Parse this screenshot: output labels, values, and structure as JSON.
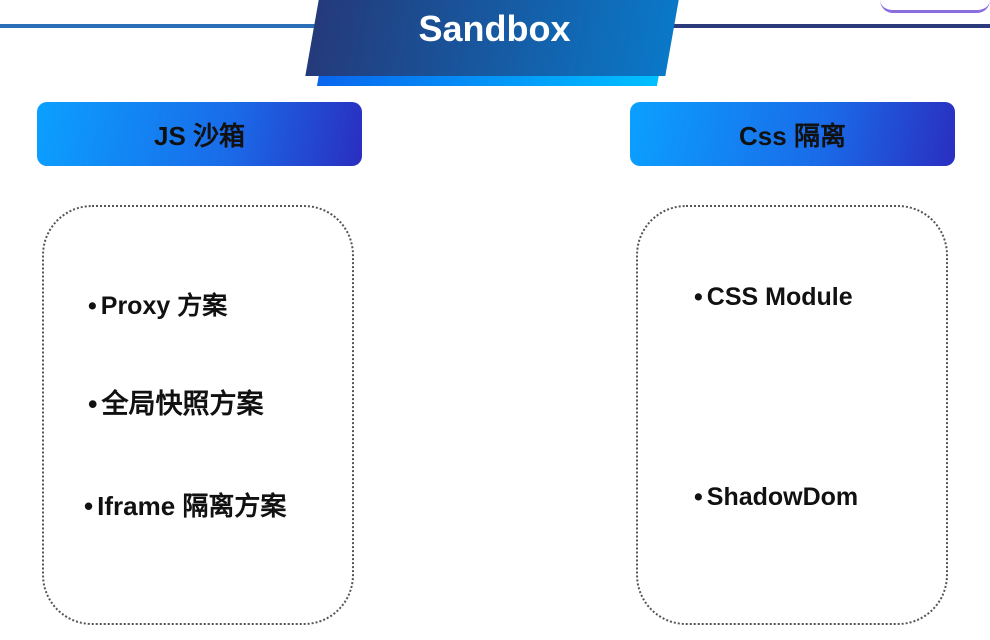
{
  "title": "Sandbox",
  "left": {
    "heading": "JS 沙箱",
    "items": [
      "Proxy 方案",
      "全局快照方案",
      "Iframe 隔离方案"
    ]
  },
  "right": {
    "heading": "Css 隔离",
    "items": [
      "CSS Module",
      "ShadowDom"
    ]
  }
}
